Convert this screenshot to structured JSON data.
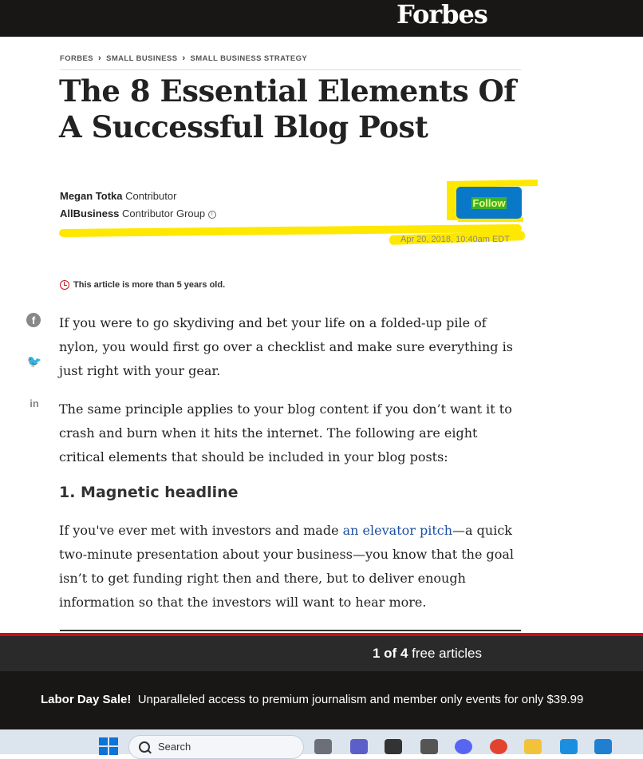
{
  "header": {
    "logo": "Forbes"
  },
  "breadcrumb": [
    "FORBES",
    "SMALL BUSINESS",
    "SMALL BUSINESS STRATEGY"
  ],
  "article": {
    "title": "The 8 Essential Elements Of A Successful Blog Post",
    "author_name": "Megan Totka",
    "author_role": "Contributor",
    "group_name": "AllBusiness",
    "group_role": "Contributor Group",
    "follow_label": "Follow",
    "date": "Apr 20, 2018, 10:40am EDT",
    "age_notice": "This article is more than 5 years old.",
    "p1": "If you were to go skydiving and bet your life on a folded-up pile of nylon, you would first go over a checklist and make sure everything is just right with your gear.",
    "p2": "The same principle applies to your blog content if you don’t want it to crash and burn when it hits the internet. The following are eight critical elements that should be included in your blog posts:",
    "h2": "1. Magnetic headline",
    "p3_before": "If you've ever met with investors and made ",
    "p3_link": "an elevator pitch",
    "p3_after": "—a quick two-minute presentation about your business—you know that the goal isn’t to get funding right then and there, but to deliver enough information so that the investors will want to hear more."
  },
  "share": {
    "facebook_icon": "f",
    "twitter_icon": "🐦",
    "linkedin_icon": "in"
  },
  "meter": {
    "count": "1 of 4",
    "text": " free articles"
  },
  "sale": {
    "bold": "Labor Day Sale!",
    "text": "Unparalleled access to premium journalism and member only events for only $39.99"
  },
  "taskbar": {
    "search_label": "Search"
  },
  "colors": {
    "highlight": "#ffe800",
    "follow": "#0a78c9",
    "topbar": "#181716",
    "red": "#c80f16"
  }
}
